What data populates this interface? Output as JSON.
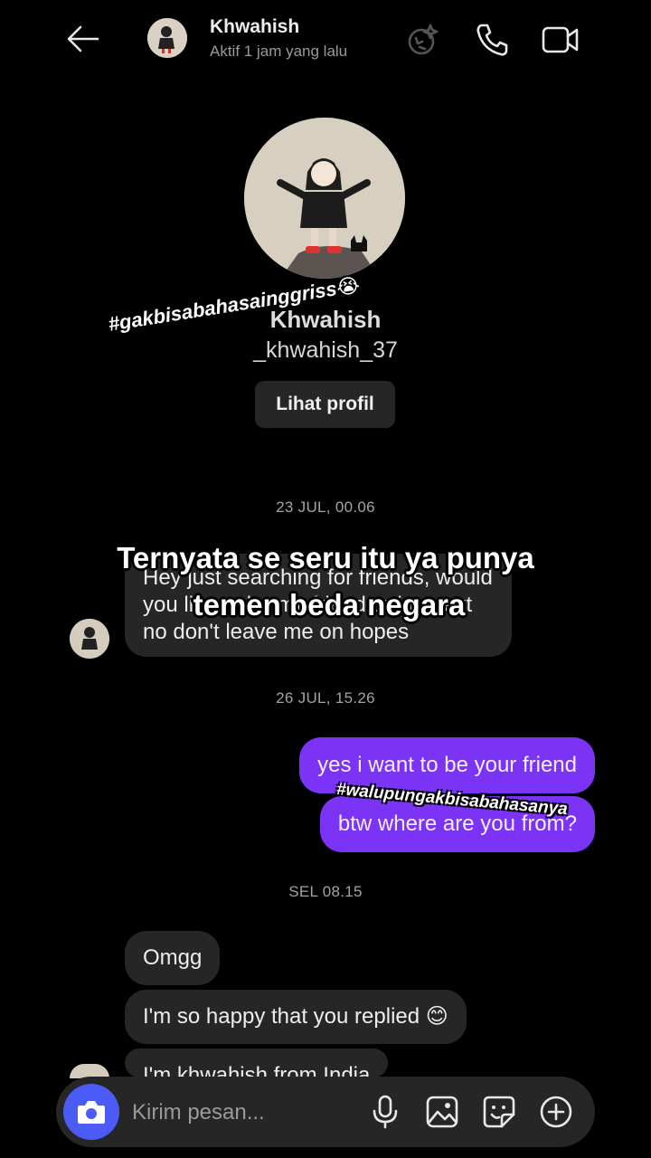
{
  "header": {
    "name": "Khwahish",
    "status": "Aktif 1 jam yang lalu",
    "icons": [
      "back-arrow-icon",
      "ai-sparkle-icon",
      "phone-icon",
      "video-camera-icon"
    ]
  },
  "profile": {
    "name": "Khwahish",
    "username": "_khwahish_37",
    "view_button": "Lihat profil"
  },
  "conversation": {
    "timestamps": [
      "23 JUL, 00.06",
      "26 JUL, 15.26",
      "SEL 08.15"
    ],
    "incoming_first": "Hey just searching for friends, would you like to be my friend or just text no don't leave me on hopes",
    "outgoing": [
      "yes i want to be your friend",
      "btw where are you from?"
    ],
    "incoming_later": [
      "Omgg",
      "I'm so happy that you replied 😊",
      "I'm khwahish from India"
    ]
  },
  "overlay": {
    "caption_line1": "Ternyata se seru itu ya punya",
    "caption_line2": "temen beda negara",
    "hashtag_top": "#gakbisabahasainggriss😭",
    "hashtag_mid": "#walupungakbisabahasanya"
  },
  "composer": {
    "placeholder": "Kirim pesan...",
    "icons": [
      "camera-icon",
      "microphone-icon",
      "image-icon",
      "sticker-icon",
      "plus-icon"
    ]
  },
  "colors": {
    "background": "#000000",
    "incoming_bubble": "#262626",
    "outgoing_bubble": "#7b34f5",
    "camera_button": "#4a5cf5"
  }
}
